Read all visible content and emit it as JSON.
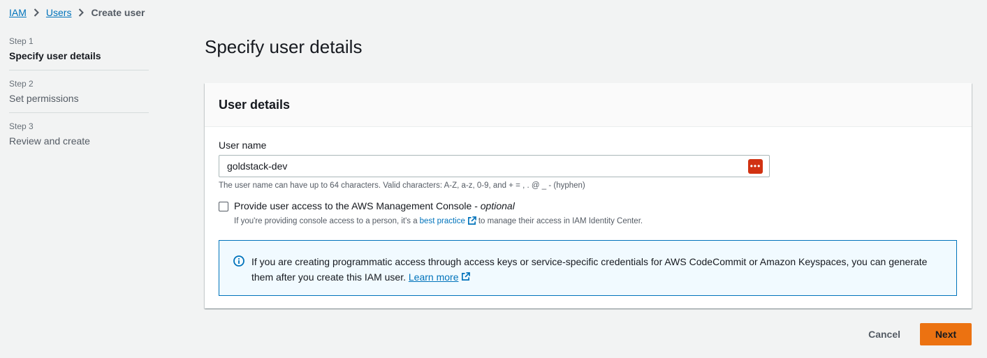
{
  "breadcrumb": {
    "items": [
      "IAM",
      "Users"
    ],
    "current": "Create user"
  },
  "steps": [
    {
      "num": "Step 1",
      "label": "Specify user details",
      "active": true
    },
    {
      "num": "Step 2",
      "label": "Set permissions",
      "active": false
    },
    {
      "num": "Step 3",
      "label": "Review and create",
      "active": false
    }
  ],
  "page": {
    "title": "Specify user details"
  },
  "panel": {
    "title": "User details",
    "username": {
      "label": "User name",
      "value": "goldstack-dev",
      "help": "The user name can have up to 64 characters. Valid characters: A-Z, a-z, 0-9, and + = , . @ _ - (hyphen)"
    },
    "console_access": {
      "label": "Provide user access to the AWS Management Console - ",
      "optional": "optional",
      "checked": false,
      "desc_before": "If you're providing console access to a person, it's a",
      "desc_link": "best practice",
      "desc_after": "to manage their access in IAM Identity Center."
    },
    "info": {
      "text": "If you are creating programmatic access through access keys or service-specific credentials for AWS CodeCommit or Amazon Keyspaces, you can generate them after you create this IAM user.",
      "link": "Learn more"
    }
  },
  "footer": {
    "cancel": "Cancel",
    "next": "Next"
  },
  "colors": {
    "link": "#0073bb",
    "primary": "#ec7211",
    "info_bg": "#f1faff"
  },
  "icons": {
    "password_manager": "password-manager-icon",
    "external": "external-link-icon",
    "info": "info-icon",
    "separator": "chevron-right-icon"
  }
}
